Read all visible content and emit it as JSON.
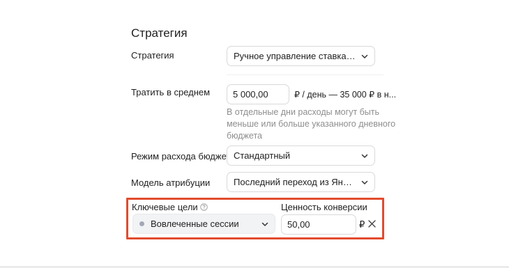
{
  "section": {
    "title": "Стратегия"
  },
  "strategy": {
    "label": "Стратегия",
    "value": "Ручное управление ставками с опти..."
  },
  "spend": {
    "label": "Тратить в среднем",
    "value": "5 000,00",
    "suffix": "₽ / день — 35 000 ₽ в н...",
    "hint_line1": "В отдельные дни расходы могут быть",
    "hint_line2": "меньше или больше указанного дневного",
    "hint_line3": "бюджета"
  },
  "budget_mode": {
    "label": "Режим расхода бюджета",
    "value": "Стандартный"
  },
  "attribution": {
    "label": "Модель атрибуции",
    "value": "Последний переход из Яндекс.Дире..."
  },
  "goals": {
    "label": "Ключевые цели",
    "value": "Вовлеченные сессии"
  },
  "conversion": {
    "label": "Ценность конверсии",
    "value": "50,00",
    "currency": "₽"
  },
  "colors": {
    "highlight": "#e34b2e",
    "hint": "#8e8e8e",
    "border": "#d9d9d9"
  }
}
